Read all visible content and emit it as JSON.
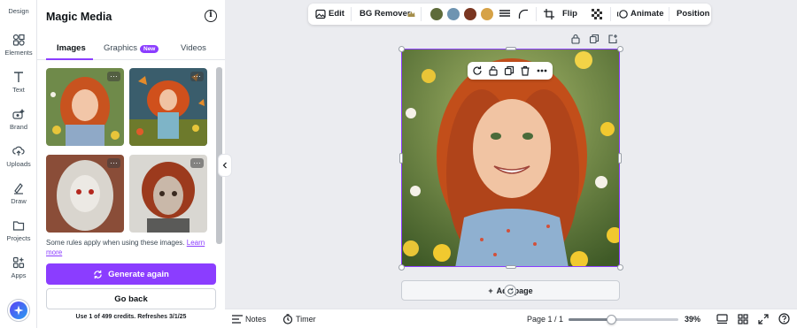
{
  "rail": {
    "items": [
      {
        "label": "Design",
        "icon": "design-icon"
      },
      {
        "label": "Elements",
        "icon": "elements-icon"
      },
      {
        "label": "Text",
        "icon": "text-icon"
      },
      {
        "label": "Brand",
        "icon": "brand-icon"
      },
      {
        "label": "Uploads",
        "icon": "uploads-icon"
      },
      {
        "label": "Draw",
        "icon": "draw-icon"
      },
      {
        "label": "Projects",
        "icon": "projects-icon"
      },
      {
        "label": "Apps",
        "icon": "apps-icon"
      }
    ],
    "magic_icon": "sparkle-icon"
  },
  "panel": {
    "title": "Magic Media",
    "tabs": [
      {
        "label": "Images"
      },
      {
        "label": "Graphics"
      },
      {
        "label": "Videos"
      }
    ],
    "new_badge": "New",
    "rules_text": "Some rules apply when using these images. ",
    "rules_link": "Learn more",
    "generate_label": "Generate again",
    "back_label": "Go back",
    "credits": "Use 1 of 499 credits. Refreshes 3/1/25"
  },
  "toolbar": {
    "edit": "Edit",
    "bg_remover": "BG Remover",
    "flip": "Flip",
    "animate": "Animate",
    "position": "Position",
    "swatches": [
      "#5e6b3a",
      "#6e94b1",
      "#7a3621",
      "#d6a246"
    ]
  },
  "canvas": {
    "add_page": "Add page"
  },
  "bottombar": {
    "notes": "Notes",
    "timer": "Timer",
    "page": "Page 1 / 1",
    "zoom": "39%",
    "zoom_fraction": 0.39
  },
  "colors": {
    "accent": "#8b3dff"
  }
}
